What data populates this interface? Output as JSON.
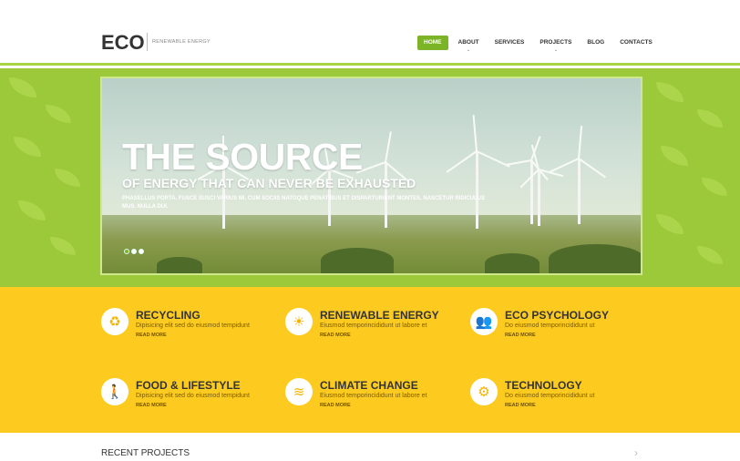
{
  "header": {
    "logo": "ECO",
    "tagline": "RENEWABLE ENERGY"
  },
  "nav": {
    "items": [
      {
        "label": "HOME",
        "active": true
      },
      {
        "label": "ABOUT",
        "dropdown": true
      },
      {
        "label": "SERVICES"
      },
      {
        "label": "PROJECTS",
        "dropdown": true
      },
      {
        "label": "BLOG"
      },
      {
        "label": "CONTACTS"
      }
    ]
  },
  "hero": {
    "title": "THE SOURCE",
    "subtitle": "OF ENERGY THAT CAN NEVER BE EXHAUSTED",
    "text": "PHASELLUS PORTA. FUSCE SUSCI VARIUS MI. CUM SOCIIS NATOQUE PENATIBUS ET DISPARTURIENT MONTES, NASCETUR RIDICULUS MUS. NULLA DUI."
  },
  "features": [
    {
      "icon": "recycle-icon",
      "glyph": "♻",
      "title": "RECYCLING",
      "desc": "Dipisicing elit sed do eiusmod tempidunt",
      "more": "READ MORE"
    },
    {
      "icon": "sun-icon",
      "glyph": "☀",
      "title": "RENEWABLE ENERGY",
      "desc": "Eiusmod temporincididunt ut labore et",
      "more": "READ MORE"
    },
    {
      "icon": "people-icon",
      "glyph": "👥",
      "title": "ECO PSYCHOLOGY",
      "desc": "Do eiusmod temporincididunt ut",
      "more": "READ MORE"
    },
    {
      "icon": "walking-person-icon",
      "glyph": "🚶",
      "title": "FOOD & LIFESTYLE",
      "desc": "Dipisicing elit sed do eiusmod tempidunt",
      "more": "READ MORE"
    },
    {
      "icon": "waves-icon",
      "glyph": "≋",
      "title": "CLIMATE CHANGE",
      "desc": "Eiusmod temporincididunt ut labore et",
      "more": "READ MORE"
    },
    {
      "icon": "gears-icon",
      "glyph": "⚙",
      "title": "TECHNOLOGY",
      "desc": "Do eiusmod temporincididunt ut",
      "more": "READ MORE"
    }
  ],
  "recent": {
    "title": "RECENT PROJECTS",
    "arrow": "›"
  },
  "colors": {
    "accent_green": "#7cb428",
    "band_green": "#9cc93a",
    "features_yellow": "#fdcb1f"
  }
}
